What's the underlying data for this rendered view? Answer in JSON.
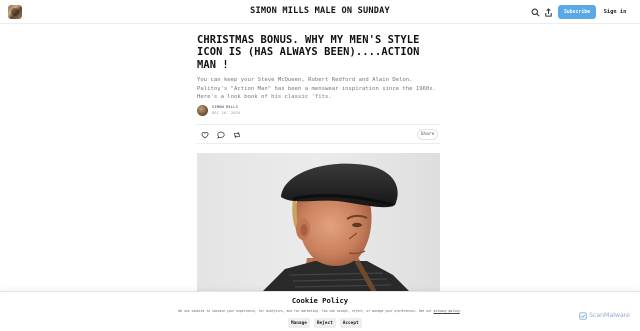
{
  "header": {
    "publication_title": "SIMON MILLS MALE ON SUNDAY",
    "subscribe_label": "Subscribe",
    "signin_label": "Sign in"
  },
  "post": {
    "title": "CHRISTMAS BONUS. WHY MY MEN'S STYLE ICON IS (HAS ALWAYS BEEN)....ACTION MAN !",
    "subtitle": "You can keep your Steve McQueen, Robert Redford and Alain Delon. Palitoy's \"Action Man\" has been a menswear inspiration since the 1960s. Here's a look book of his classic 'fits.",
    "author": "SIMON MILLS",
    "date": "DEC 26, 2024",
    "share_label": "Share"
  },
  "cookie_banner": {
    "title": "Cookie Policy",
    "text": "We use cookies to improve your experience, for analytics, and for marketing. You can accept, reject, or manage your preferences. See our",
    "policy_link": "privacy policy",
    "text_end": ".",
    "manage_label": "Manage",
    "reject_label": "Reject",
    "accept_label": "Accept"
  },
  "overlay_badge": {
    "label": "ScanMalware"
  },
  "colors": {
    "subscribe_bg": "#5aa9e6",
    "badge_text": "#7fa6c9"
  },
  "icons": {
    "search": "search-icon",
    "share_top": "share-upload-icon",
    "like": "heart-icon",
    "comment": "comment-icon",
    "restack": "restack-icon"
  }
}
